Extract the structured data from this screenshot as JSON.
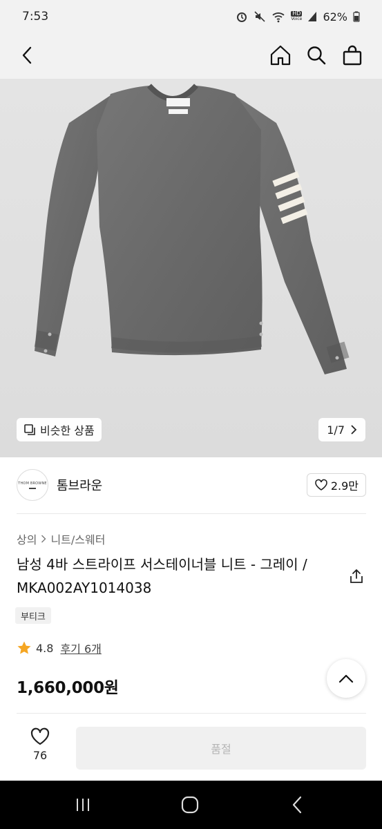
{
  "status_bar": {
    "time": "7:53",
    "battery": "62%",
    "hd_label": "HD",
    "voice_label": "Voice"
  },
  "nav": {
    "back_icon": "chevron-left-icon",
    "home_icon": "home-icon",
    "search_icon": "search-icon",
    "cart_icon": "shopping-bag-icon"
  },
  "hero": {
    "similar_label": "비슷한 상품",
    "counter": "1/7",
    "stripe_color": "#f3efe6",
    "garment_color": "#6e6e6e"
  },
  "brand": {
    "logo_text": "THOM BROWNE",
    "name": "톰브라운",
    "likes": "2.9만"
  },
  "breadcrumb": {
    "level1": "상의",
    "level2": "니트/스웨터"
  },
  "product": {
    "title": "남성 4바 스트라이프 서스테이너블 니트 - 그레이 / MKA002AY1014038",
    "tag": "부티크",
    "rating": "4.8",
    "reviews": "후기 6개",
    "price": "1,660,000원"
  },
  "bottom": {
    "wish_count": "76",
    "soldout_label": "품절"
  },
  "colors": {
    "star": "#f5a623",
    "soldout_bg": "#f0f0f0"
  }
}
